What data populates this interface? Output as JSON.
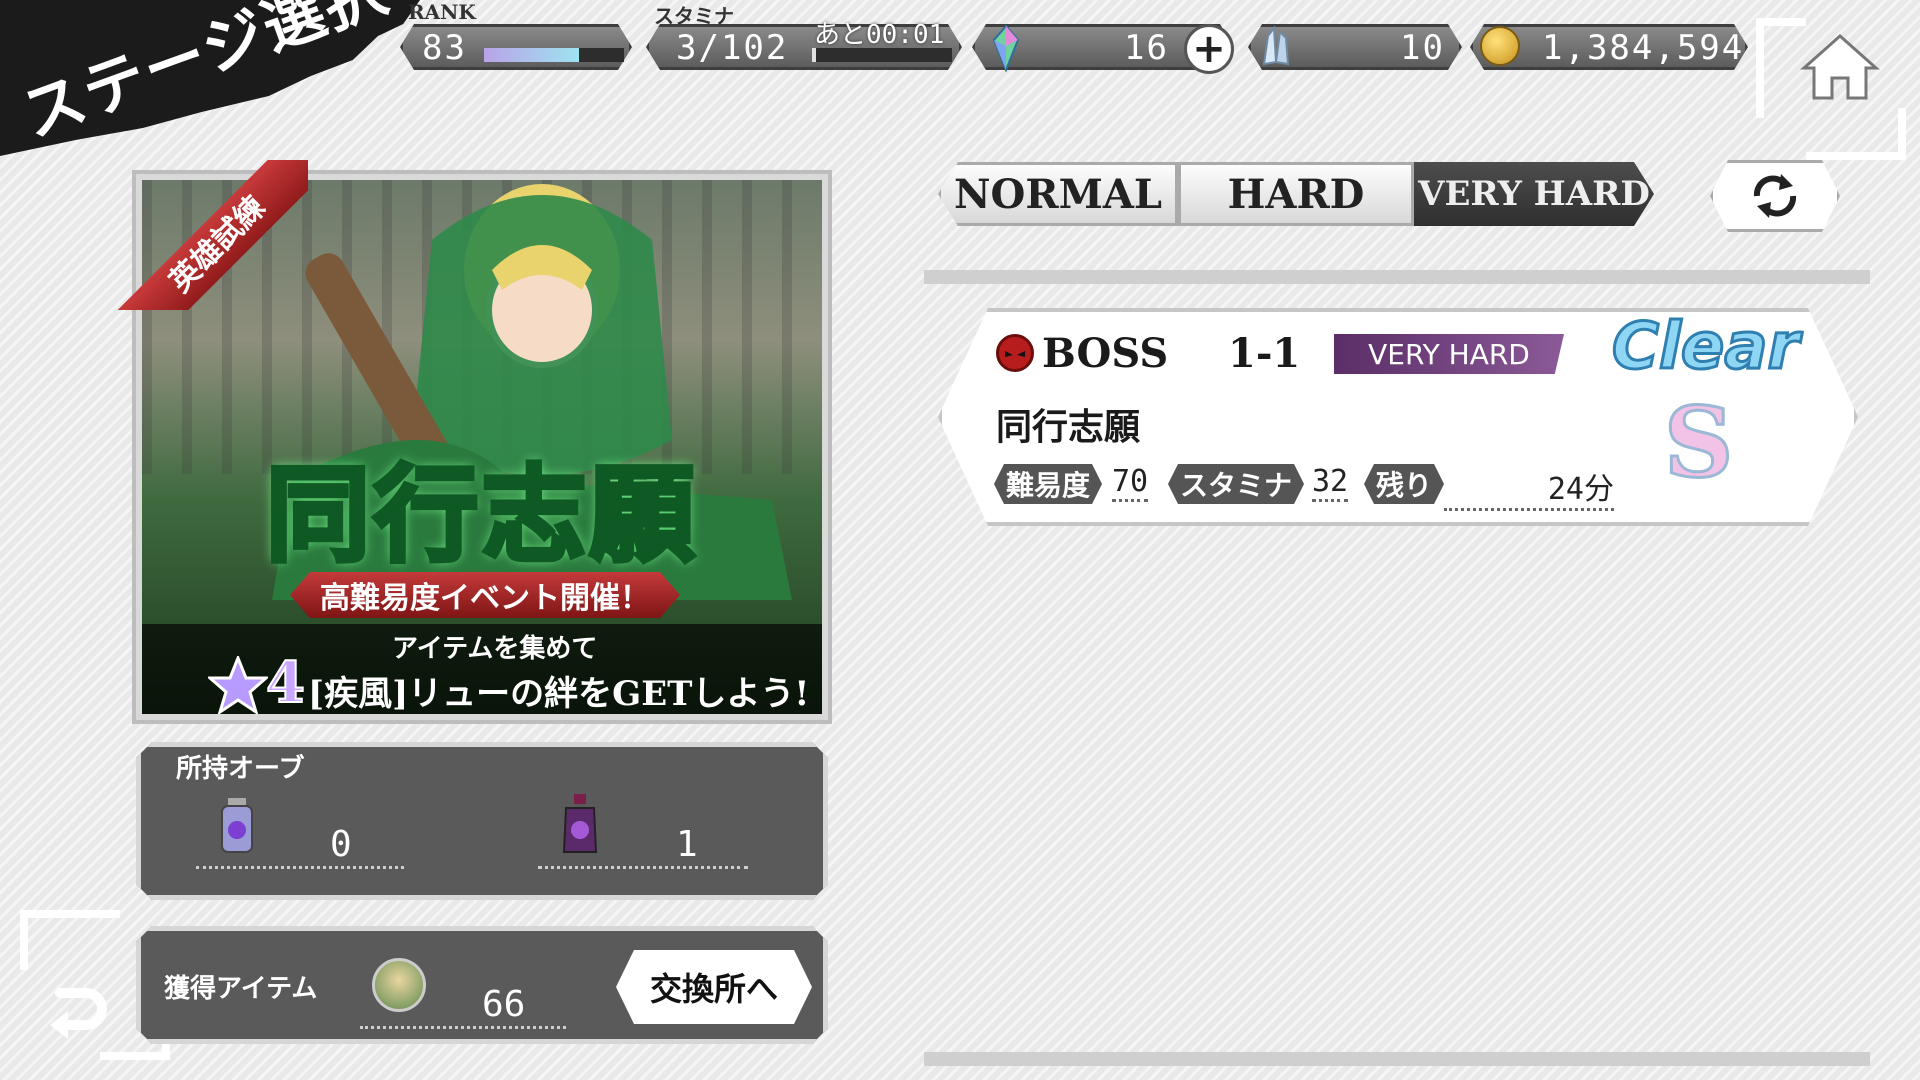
{
  "header": {
    "title": "ステージ選択",
    "rank_label": "RANK",
    "rank_value": "83",
    "rank_progress": 0.68,
    "stamina_label": "スタミナ",
    "stamina_value": "3/102",
    "stamina_timer": "あと00:01",
    "stamina_progress": 0.03,
    "gems_value": "16",
    "crystals_value": "10",
    "gold_value": "1,384,594"
  },
  "tabs": [
    {
      "label": "NORMAL"
    },
    {
      "label": "HARD"
    },
    {
      "label": "VERY HARD",
      "selected": true
    }
  ],
  "stage": {
    "type_label": "BOSS",
    "stage_number": "1-1",
    "difficulty_badge": "VERY HARD",
    "clear_label": "Clear",
    "name": "同行志願",
    "rank": "S",
    "difficulty_label": "難易度",
    "difficulty_value": "70",
    "stamina_label": "スタミナ",
    "stamina_value": "32",
    "remaining_label": "残り",
    "remaining_value": "24分"
  },
  "banner": {
    "corner_ribbon": "英雄試練",
    "title": "同行志願",
    "subtitle": "高難易度イベント開催！",
    "line1": "アイテムを集めて",
    "star_rank": "4",
    "line2": "[疾風]リューの絆をGETしよう!"
  },
  "orbs": {
    "label": "所持オーブ",
    "orb1_count": "0",
    "orb2_count": "1"
  },
  "items": {
    "label": "獲得アイテム",
    "count": "66",
    "exchange_button": "交換所へ"
  },
  "colors": {
    "difficulty_badge_bg": "#6b3d77",
    "clear_color": "#4aa7d6",
    "banner_green": "#1f8a3a",
    "banner_ribbon_red": "#b3272d"
  }
}
